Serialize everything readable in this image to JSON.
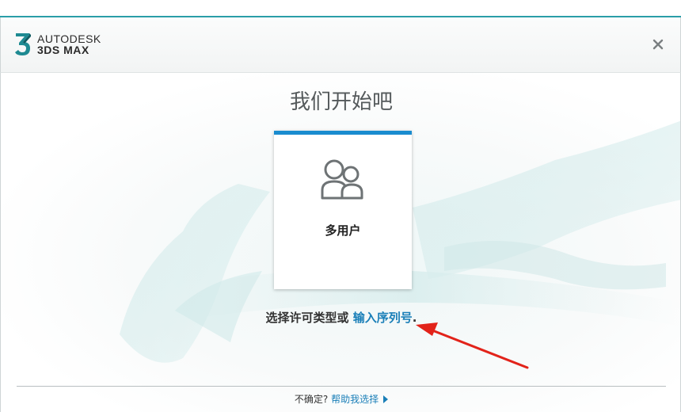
{
  "header": {
    "brand_line1": "AUTODESK",
    "brand_line2": "3DS MAX",
    "logo_icon": "3ds-max-logo-icon",
    "close_icon": "close-icon"
  },
  "main": {
    "title": "我们开始吧",
    "license_card": {
      "label": "多用户",
      "icon": "multi-user-icon",
      "accent_color": "#1a8ccf"
    },
    "prompt_text": "选择许可类型或",
    "serial_link": "输入序列号",
    "prompt_end": "."
  },
  "footer": {
    "question": "不确定?",
    "help_link": "帮助我选择",
    "help_icon": "play-triangle-icon"
  },
  "colors": {
    "link": "#1a7fb8",
    "top_border": "#2a9ea8",
    "annotation_arrow": "#e2231a"
  }
}
